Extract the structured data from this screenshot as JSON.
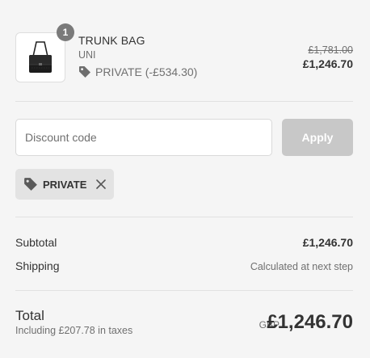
{
  "product": {
    "quantity": "1",
    "name": "TRUNK BAG",
    "variant": "UNI",
    "discount_text": "PRIVATE (-£534.30)",
    "original_price": "£1,781.00",
    "price": "£1,246.70",
    "thumbnail_icon": "bag-thumbnail"
  },
  "discount": {
    "placeholder": "Discount code",
    "apply_label": "Apply",
    "applied_code": "PRIVATE",
    "remove_icon": "close-icon"
  },
  "summary": {
    "subtotal_label": "Subtotal",
    "subtotal_value": "£1,246.70",
    "shipping_label": "Shipping",
    "shipping_value": "Calculated at next step"
  },
  "total": {
    "label": "Total",
    "tax_note": "Including £207.78 in taxes",
    "currency": "GBP",
    "amount": "£1,246.70"
  },
  "colors": {
    "background": "#f5f5f5",
    "text": "#333333",
    "muted": "#707070",
    "apply_disabled": "#c8c8c8",
    "tag_bg": "#e3e3e3"
  }
}
